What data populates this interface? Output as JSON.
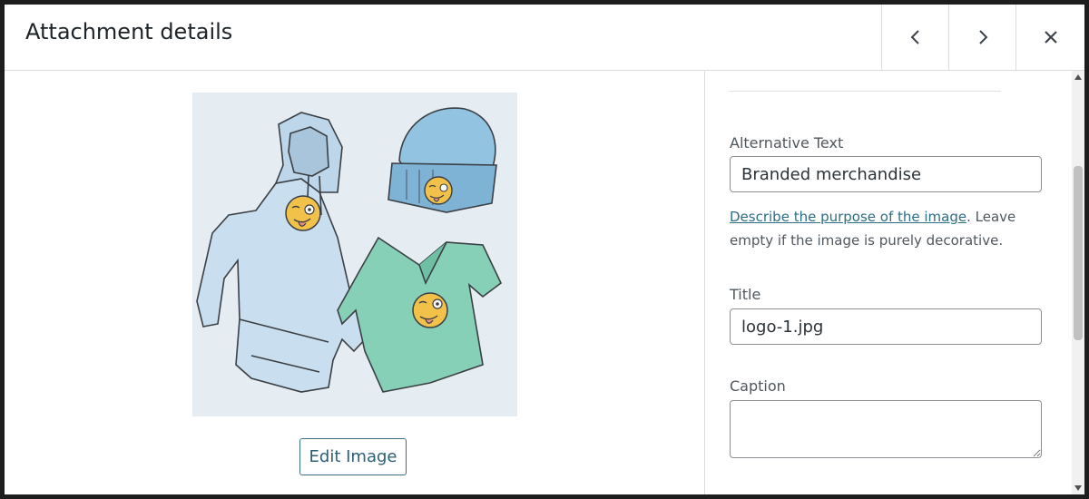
{
  "header": {
    "title": "Attachment details",
    "prev_icon": "chevron-left-icon",
    "next_icon": "chevron-right-icon",
    "close_icon": "close-icon"
  },
  "preview": {
    "edit_button_label": "Edit Image"
  },
  "sidebar": {
    "alt_text": {
      "label": "Alternative Text",
      "value": "Branded merchandise",
      "help_link": "Describe the purpose of the image",
      "help_rest": ". Leave empty if the image is purely decorative."
    },
    "title_field": {
      "label": "Title",
      "value": "logo-1.jpg"
    },
    "caption_field": {
      "label": "Caption",
      "value": ""
    }
  },
  "colors": {
    "link": "#2c6e85",
    "border": "#8c8f94",
    "divider": "#dcdcde"
  }
}
